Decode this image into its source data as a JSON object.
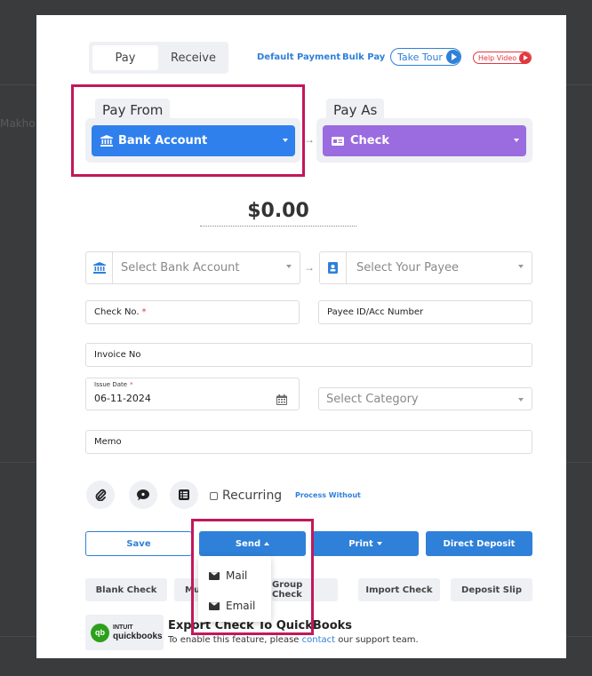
{
  "background": {
    "frag_name": "Makho"
  },
  "tabs": {
    "pay": "Pay",
    "receive": "Receive"
  },
  "top_links": {
    "default_payment": "Default Payment",
    "bulk_pay": "Bulk Pay",
    "take_tour": "Take Tour",
    "help_video": "Help Video"
  },
  "pay_from": {
    "title": "Pay From",
    "selected": "Bank Account",
    "color": "#2f80ed"
  },
  "pay_as": {
    "title": "Pay As",
    "selected": "Check",
    "color": "#9b6be0"
  },
  "amount": "$0.00",
  "form": {
    "bank_account_placeholder": "Select Bank Account",
    "payee_placeholder": "Select Your Payee",
    "check_no": "Check No.",
    "payee_id": "Payee ID/Acc Number",
    "invoice_no": "Invoice No",
    "issue_date_label": "Issue Date",
    "issue_date": "06-11-2024",
    "category_placeholder": "Select Category",
    "memo": "Memo",
    "required_mark": "*"
  },
  "options": {
    "recurring": "Recurring",
    "process_without": "Process Without"
  },
  "actions": {
    "save": "Save",
    "send": "Send",
    "print": "Print",
    "direct_deposit": "Direct Deposit"
  },
  "send_menu": {
    "mail": "Mail",
    "email": "Email"
  },
  "secondary_actions": {
    "blank_check": "Blank Check",
    "mu_partial": "Mu",
    "group_check_partial": "Group Check",
    "import_check": "Import Check",
    "deposit_slip": "Deposit Slip"
  },
  "quickbooks": {
    "logo_text_1": "INTUIT",
    "logo_text_2": "quickbooks",
    "title": "Export Check To QuickBooks",
    "desc_prefix": "To enable this feature, please",
    "contact": "contact",
    "desc_suffix": "our support team."
  },
  "colors": {
    "accent": "#2f80d9",
    "highlight": "#c2185b",
    "required": "#e0383e"
  }
}
